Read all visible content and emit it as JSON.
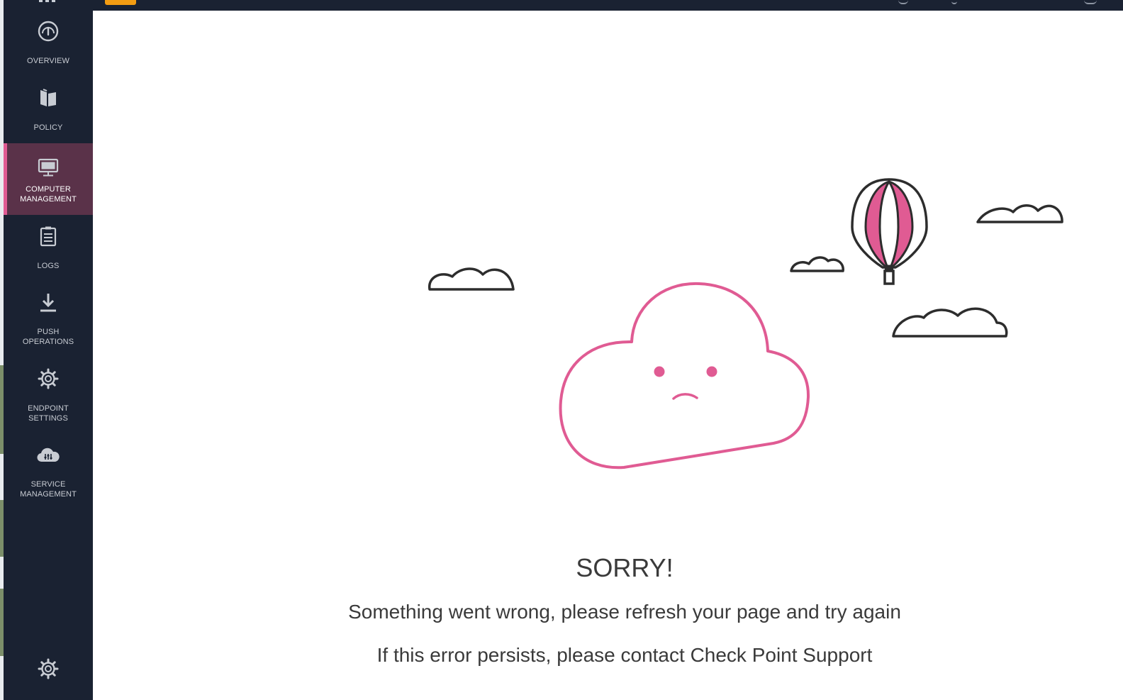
{
  "colors": {
    "sidebar_bg": "#1a2232",
    "active_bg": "#5a3249",
    "accent_pink": "#e05b93",
    "brand_orange": "#f39c12",
    "text_dark": "#3a3a3a"
  },
  "sidebar": {
    "items": [
      {
        "label": "OVERVIEW",
        "icon": "gauge-icon"
      },
      {
        "label": "POLICY",
        "icon": "book-icon"
      },
      {
        "label_line1": "COMPUTER",
        "label_line2": "MANAGEMENT",
        "icon": "monitor-icon",
        "active": true
      },
      {
        "label": "LOGS",
        "icon": "clipboard-icon"
      },
      {
        "label_line1": "PUSH",
        "label_line2": "OPERATIONS",
        "icon": "download-icon"
      },
      {
        "label_line1": "ENDPOINT",
        "label_line2": "SETTINGS",
        "icon": "gear-icon"
      },
      {
        "label_line1": "SERVICE",
        "label_line2": "MANAGEMENT",
        "icon": "cloud-settings-icon"
      }
    ],
    "bottom_icon": "gear-icon"
  },
  "error": {
    "title": "SORRY!",
    "line1": "Something went wrong, please refresh your page and try again",
    "line2": "If this error persists, please contact Check Point Support"
  }
}
